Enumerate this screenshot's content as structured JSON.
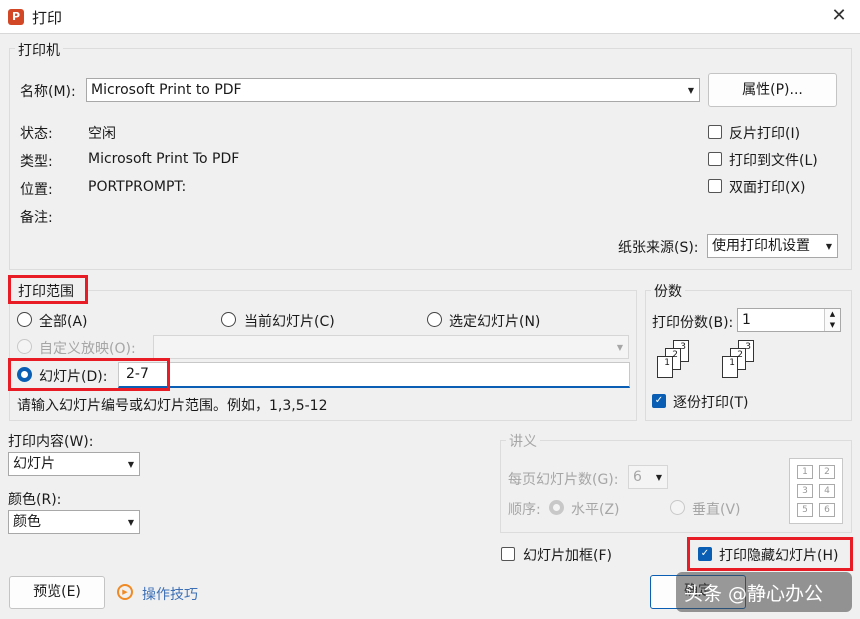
{
  "window": {
    "title": "打印",
    "app_icon": "P"
  },
  "printer": {
    "legend": "打印机",
    "name_label": "名称(M):",
    "name_value": "Microsoft Print to PDF",
    "properties_button": "属性(P)...",
    "status_label": "状态:",
    "status_value": "空闲",
    "type_label": "类型:",
    "type_value": "Microsoft Print To PDF",
    "location_label": "位置:",
    "location_value": "PORTPROMPT:",
    "comment_label": "备注:",
    "reverse_print": "反片打印(I)",
    "print_to_file": "打印到文件(L)",
    "duplex": "双面打印(X)",
    "paper_source_label": "纸张来源(S):",
    "paper_source_value": "使用打印机设置"
  },
  "range": {
    "legend": "打印范围",
    "all": "全部(A)",
    "current": "当前幻灯片(C)",
    "selected": "选定幻灯片(N)",
    "custom": "自定义放映(O):",
    "slides": "幻灯片(D):",
    "slides_value": "2-7",
    "hint": "请输入幻灯片编号或幻灯片范围。例如，1,3,5-12"
  },
  "copies": {
    "legend": "份数",
    "count_label": "打印份数(B):",
    "count_value": "1",
    "collate": "逐份打印(T)",
    "stack1": [
      "1",
      "2",
      "3"
    ],
    "stack2": [
      "1",
      "2",
      "3"
    ]
  },
  "content": {
    "print_what_label": "打印内容(W):",
    "print_what_value": "幻灯片",
    "color_label": "颜色(R):",
    "color_value": "颜色"
  },
  "handout": {
    "legend": "讲义",
    "per_page_label": "每页幻灯片数(G):",
    "per_page_value": "6",
    "order_label": "顺序:",
    "horizontal": "水平(Z)",
    "vertical": "垂直(V)",
    "preview_numbers": [
      "1",
      "2",
      "3",
      "4",
      "5",
      "6"
    ]
  },
  "options": {
    "frame": "幻灯片加框(F)",
    "print_hidden": "打印隐藏幻灯片(H)"
  },
  "footer": {
    "preview": "预览(E)",
    "tips": "操作技巧",
    "ok": "确定",
    "watermark": "头条 @静心办公"
  },
  "colors": {
    "accent": "#0a5fb4",
    "highlight": "#e81c24"
  }
}
